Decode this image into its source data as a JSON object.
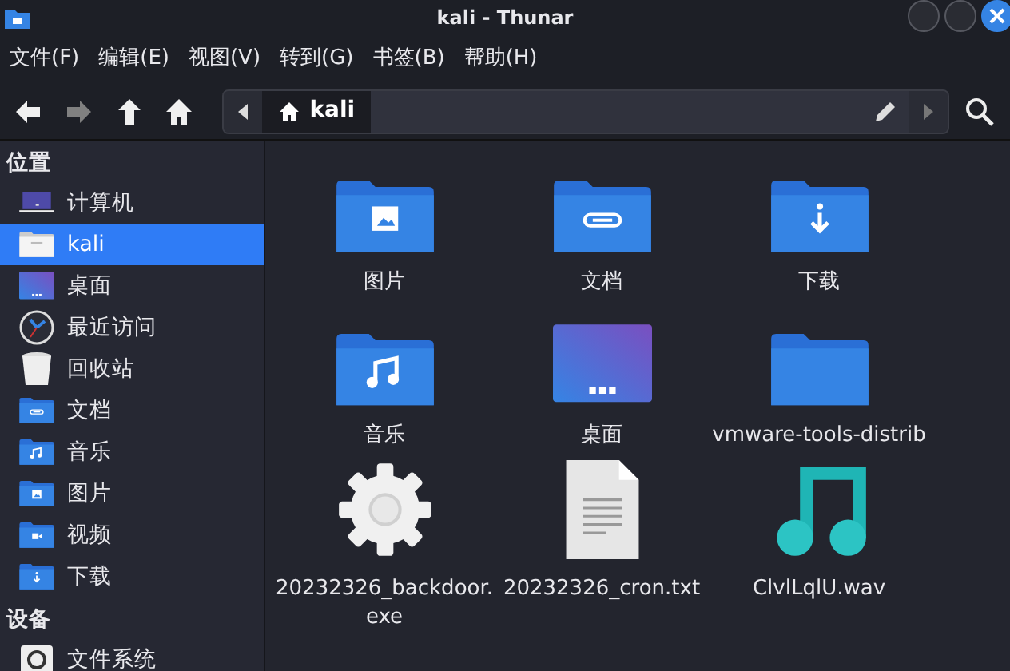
{
  "window": {
    "title": "kali - Thunar"
  },
  "menu": [
    "文件(F)",
    "编辑(E)",
    "视图(V)",
    "转到(G)",
    "书签(B)",
    "帮助(H)"
  ],
  "toolbar": [
    {
      "kind": "back",
      "disabled": false
    },
    {
      "kind": "forward",
      "disabled": true
    },
    {
      "kind": "up",
      "disabled": false
    },
    {
      "kind": "home",
      "disabled": false
    }
  ],
  "location": {
    "segment": "kali"
  },
  "sidebar": [
    {
      "heading": "位置",
      "items": [
        {
          "label": "计算机",
          "kind": "computer",
          "selected": false
        },
        {
          "label": "kali",
          "kind": "home",
          "selected": true
        },
        {
          "label": "桌面",
          "kind": "desktop",
          "selected": false
        },
        {
          "label": "最近访问",
          "kind": "recent",
          "selected": false
        },
        {
          "label": "回收站",
          "kind": "trash",
          "selected": false
        },
        {
          "label": "文档",
          "kind": "documents",
          "selected": false
        },
        {
          "label": "音乐",
          "kind": "music",
          "selected": false
        },
        {
          "label": "图片",
          "kind": "pictures",
          "selected": false
        },
        {
          "label": "视频",
          "kind": "videos",
          "selected": false
        },
        {
          "label": "下载",
          "kind": "downloads",
          "selected": false
        }
      ]
    },
    {
      "heading": "设备",
      "items": [
        {
          "label": "文件系统",
          "kind": "drive",
          "selected": false
        }
      ]
    }
  ],
  "files": [
    {
      "name": "图片",
      "kind": "pictures"
    },
    {
      "name": "文档",
      "kind": "documents"
    },
    {
      "name": "下载",
      "kind": "downloads"
    },
    {
      "name": "音乐",
      "kind": "music"
    },
    {
      "name": "桌面",
      "kind": "desktop"
    },
    {
      "name": "vmware-tools-distrib",
      "kind": "folder"
    },
    {
      "name": "20232326_backdoor.exe",
      "kind": "executable"
    },
    {
      "name": "20232326_cron.txt",
      "kind": "text"
    },
    {
      "name": "ClvlLqlU.wav",
      "kind": "audio"
    }
  ]
}
